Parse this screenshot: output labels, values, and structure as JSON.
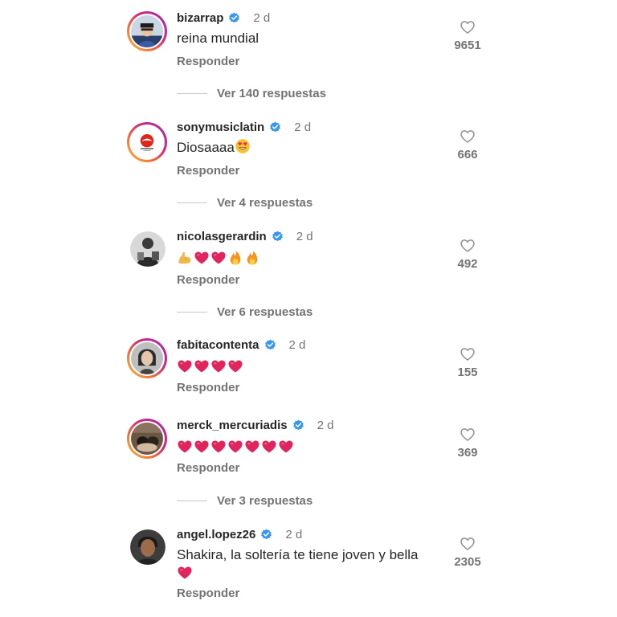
{
  "reply_label": "Responder",
  "comments": [
    {
      "username": "bizarrap",
      "time": "2 d",
      "text": "reina mundial",
      "likes": "9651",
      "more": "Ver 140 respuestas"
    },
    {
      "username": "sonymusiclatin",
      "time": "2 d",
      "text": "Diosaaaa",
      "likes": "666",
      "more": "Ver 4 respuestas"
    },
    {
      "username": "nicolasgerardin",
      "time": "2 d",
      "text": "",
      "likes": "492",
      "more": "Ver 6 respuestas"
    },
    {
      "username": "fabitacontenta",
      "time": "2 d",
      "text": "",
      "likes": "155",
      "more": ""
    },
    {
      "username": "merck_mercuriadis",
      "time": "2 d",
      "text": "",
      "likes": "369",
      "more": "Ver 3 respuestas"
    },
    {
      "username": "angel.lopez26",
      "time": "2 d",
      "text": "Shakira, la soltería te tiene joven y bella",
      "likes": "2305",
      "more": ""
    }
  ],
  "icons": {
    "verified": "verified-badge-icon",
    "like": "heart-outline-icon",
    "emojis": [
      "heart-eyes-emoji",
      "flexed-biceps-emoji",
      "red-heart-emoji",
      "fire-emoji"
    ]
  },
  "colors": {
    "verified": "#3897f0",
    "heart": "#e0245e",
    "muted": "#737373"
  }
}
